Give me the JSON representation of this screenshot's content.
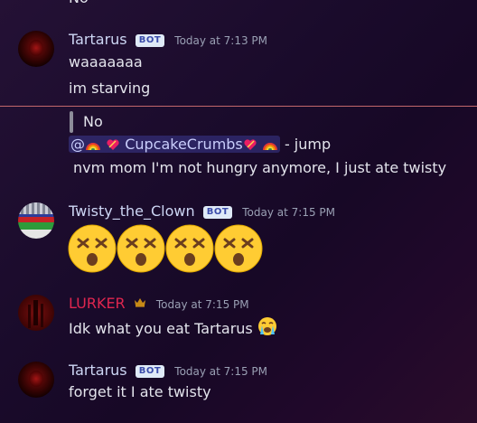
{
  "top_fragment": "No",
  "messages": [
    {
      "username": "Tartarus",
      "bot_tag": "BOT",
      "timestamp": "Today at 7:13 PM",
      "lines": [
        "waaaaaaa",
        "im starving"
      ]
    },
    {
      "quote": "No",
      "mention_name": "CupcakeCrumbs",
      "mention_prefix": "@",
      "reply_suffix": " - jump",
      "line": "nvm mom I'm not hungry anymore, I just ate twisty"
    },
    {
      "username": "Twisty_the_Clown",
      "bot_tag": "BOT",
      "timestamp": "Today at 7:15 PM",
      "emoji_count": 4,
      "emoji_name": "dizzy-face-emoji"
    },
    {
      "username": "LURKER",
      "timestamp": "Today at 7:15 PM",
      "line": "Idk what you eat Tartarus",
      "emoji_name": "crying-face-emoji"
    },
    {
      "username": "Tartarus",
      "bot_tag": "BOT",
      "timestamp": "Today at 7:15 PM",
      "line": "forget it I ate twisty"
    }
  ],
  "colors": {
    "divider": "#c2676b",
    "lurker_name": "#e0264f",
    "bot_tag_bg": "#dfeaf7"
  }
}
